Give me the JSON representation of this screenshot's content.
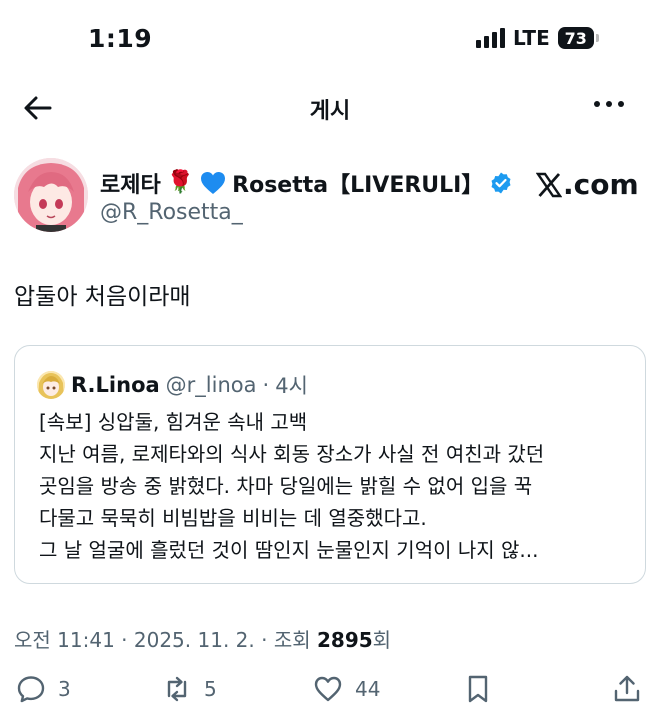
{
  "status_bar": {
    "time": "1:19",
    "network": "LTE",
    "battery": "73"
  },
  "header": {
    "title": "게시"
  },
  "author": {
    "name": "로제타",
    "rose": "🌹",
    "display_suffix": "Rosetta【LIVERULI】",
    "handle": "@R_Rosetta_"
  },
  "watermark": "𝕏.com",
  "watermark_text": ".com",
  "tweet": {
    "text": "압둘아 처음이라매"
  },
  "quote": {
    "name": "R.Linoa",
    "handle": "@r_linoa",
    "separator": "·",
    "time": "4시",
    "lines": [
      "[속보] 싱압둘, 힘겨운 속내 고백",
      "지난 여름, 로제타와의 식사 회동 장소가 사실 전 여친과 갔던",
      "곳임을 방송 중 밝혔다. 차마 당일에는 밝힐 수 없어 입을 꾹",
      "다물고 묵묵히 비빔밥을 비비는 데 열중했다고.",
      "그 날 얼굴에 흘렀던 것이 땀인지 눈물인지 기억이 나지 않..."
    ]
  },
  "meta": {
    "time": "오전 11:41",
    "sep1": "·",
    "date": "2025. 11. 2.",
    "sep2": "·",
    "views_prefix": "조회",
    "views": "2895",
    "views_suffix": "회"
  },
  "actions": {
    "replies": "3",
    "retweets": "5",
    "likes": "44"
  },
  "colors": {
    "text": "#0f1419",
    "secondary": "#536471",
    "verified": "#1d9bf0",
    "heart": "#1d8cf0",
    "border": "#cfd9de"
  }
}
